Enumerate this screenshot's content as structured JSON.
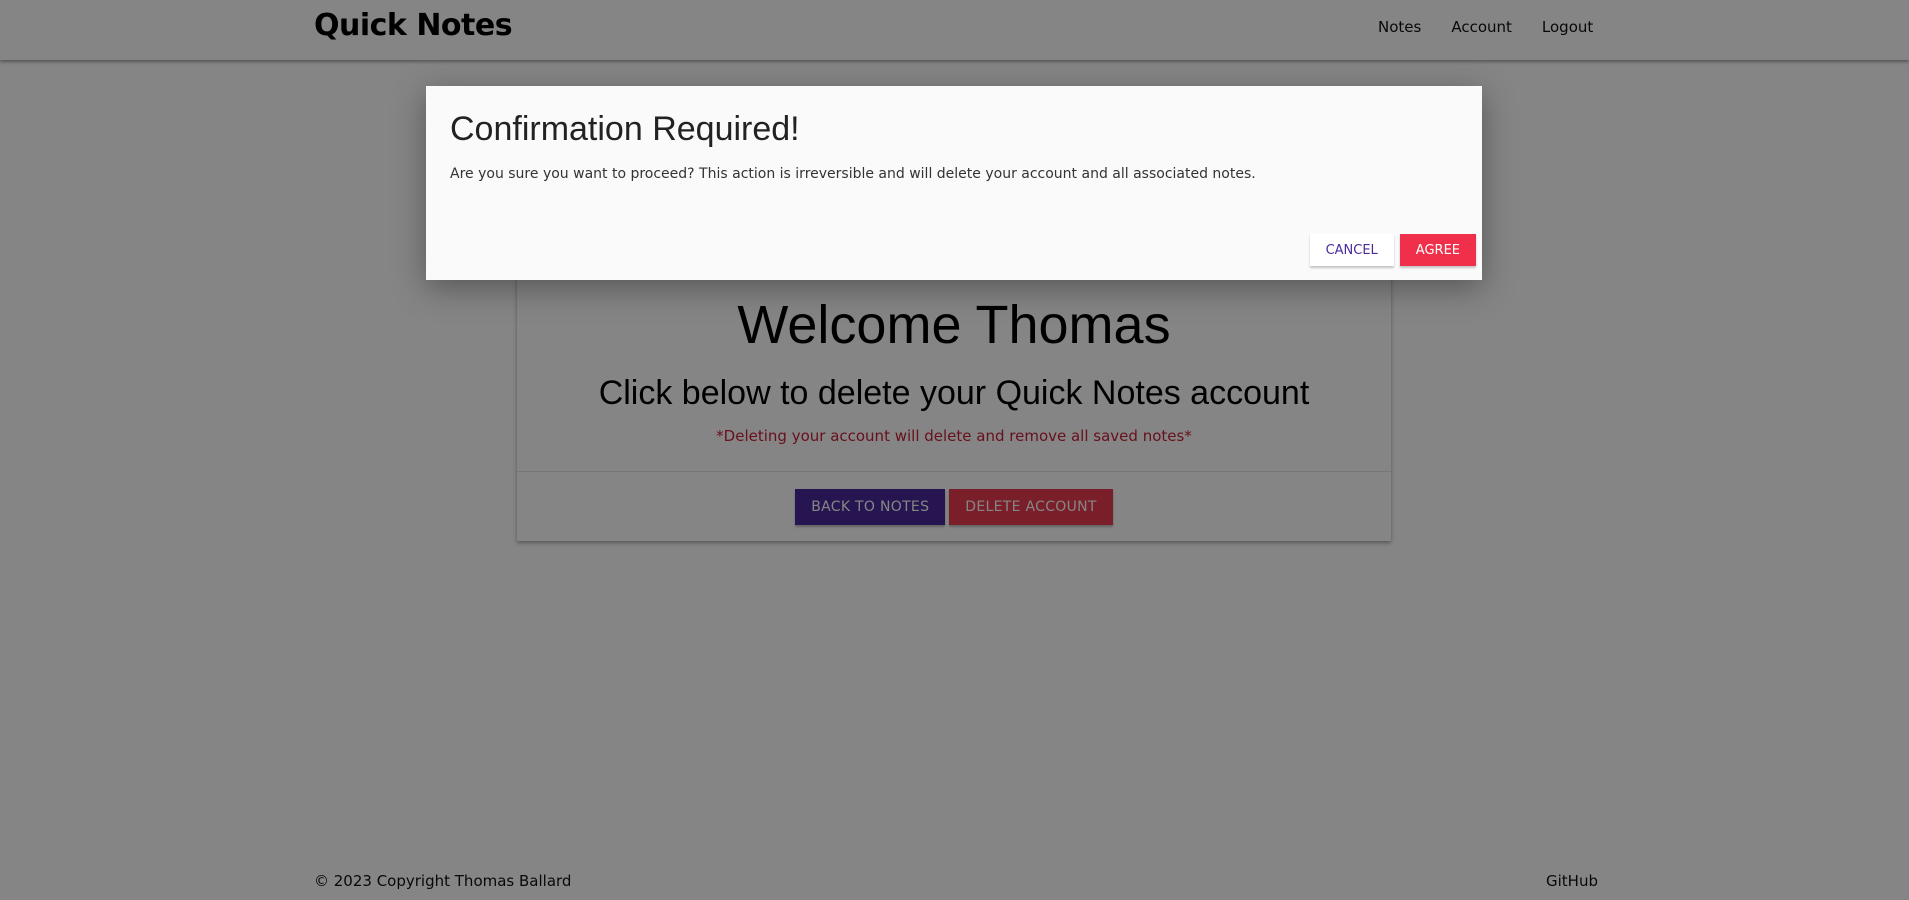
{
  "navbar": {
    "brand": "Quick Notes",
    "links": [
      "Notes",
      "Account",
      "Logout"
    ]
  },
  "card": {
    "welcome": "Welcome Thomas",
    "subtitle": "Click below to delete your Quick Notes account",
    "warning": "*Deleting your account will delete and remove all saved notes*",
    "back_button": "BACK TO NOTES",
    "delete_button": "DELETE ACCOUNT"
  },
  "footer": {
    "copyright": "© 2023 Copyright Thomas Ballard",
    "github": "GitHub"
  },
  "modal": {
    "title": "Confirmation Required!",
    "message": "Are you sure you want to proceed? This action is irreversible and will delete your account and all associated notes.",
    "cancel_label": "CANCEL",
    "agree_label": "AGREE"
  },
  "colors": {
    "primary_purple": "#4b2a9b",
    "danger_red": "#ea3a4f",
    "agree_red": "#f0304a",
    "warning_text": "#c62238"
  }
}
